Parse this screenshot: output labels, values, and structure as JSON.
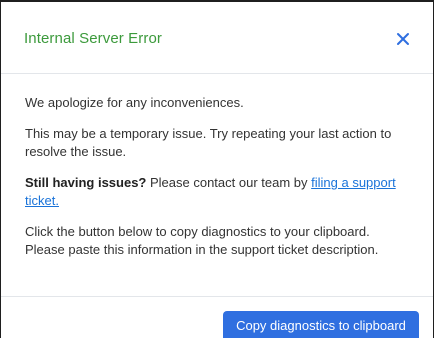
{
  "dialog": {
    "title": "Internal Server Error",
    "close_icon": "close-icon",
    "colors": {
      "title": "#3c9a3c",
      "close": "#2f6fe0",
      "link": "#1a73d9",
      "button_bg": "#2f6fe0",
      "button_text": "#ffffff"
    }
  },
  "content": {
    "apology": "We apologize for any inconveniences.",
    "temporary": "This may be a temporary issue. Try repeating your last action to resolve the issue.",
    "still_having_bold": "Still having issues?",
    "still_having_text": " Please contact our team by ",
    "support_link": "filing a support ticket.",
    "copy_instructions": "Click the button below to copy diagnostics to your clipboard. Please paste this information in the support ticket description."
  },
  "footer": {
    "copy_button_label": "Copy diagnostics to clipboard"
  }
}
